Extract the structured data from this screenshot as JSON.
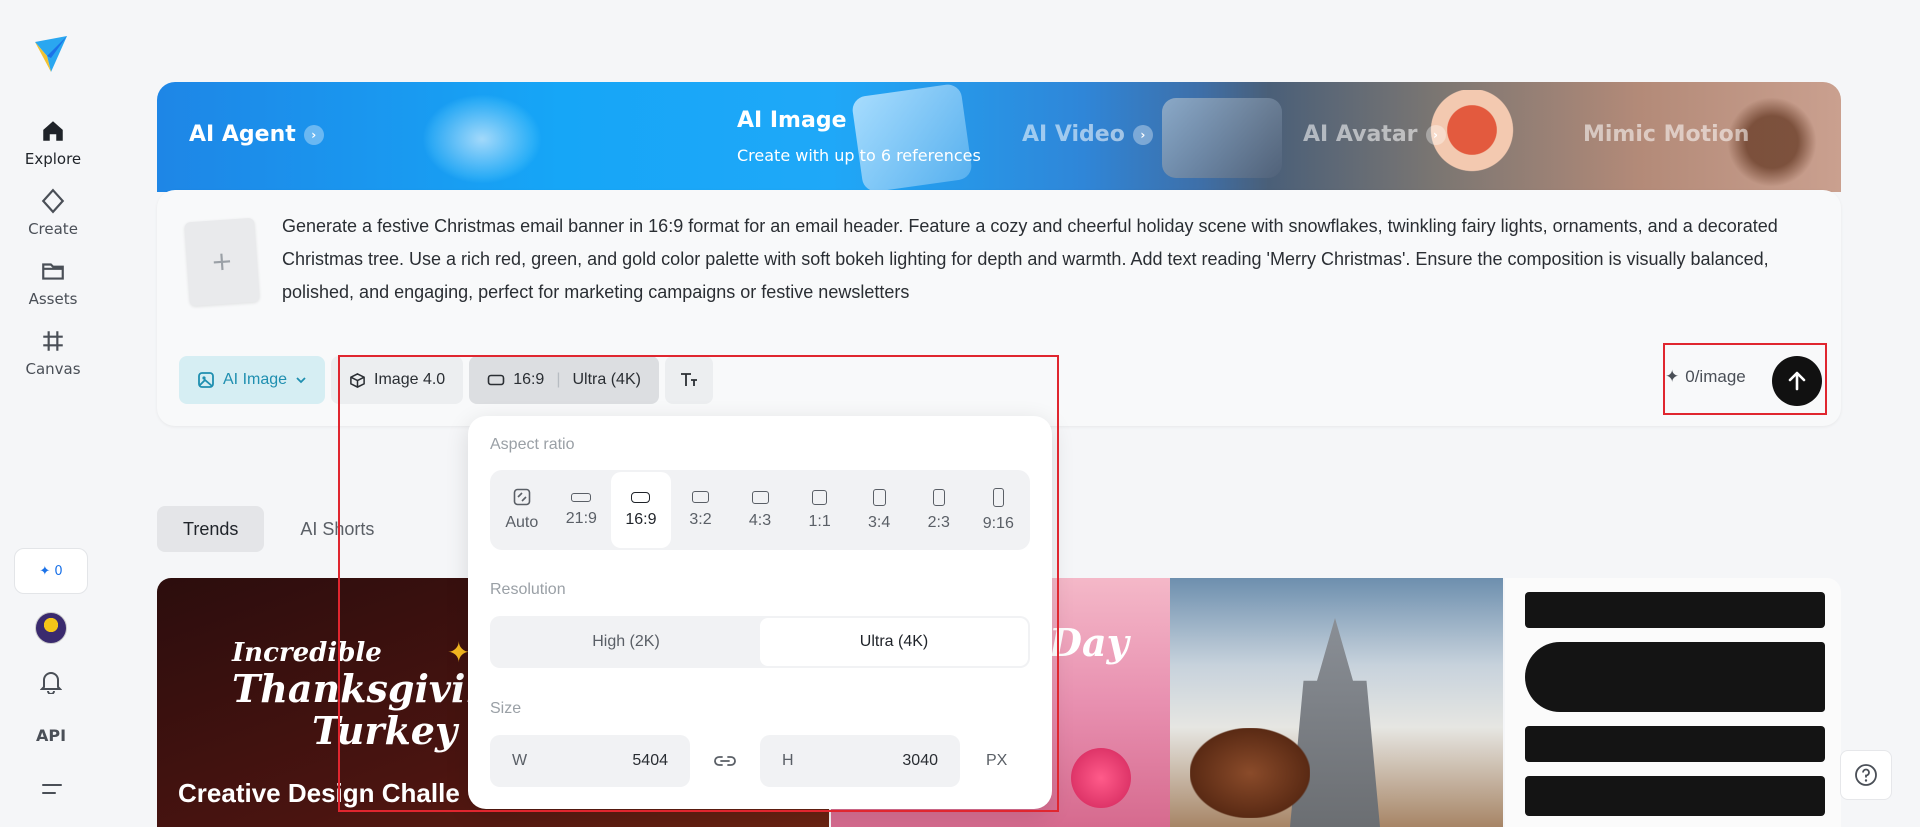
{
  "sidebar": {
    "items": [
      {
        "label": "Explore",
        "icon": "home-icon"
      },
      {
        "label": "Create",
        "icon": "diamond-icon"
      },
      {
        "label": "Assets",
        "icon": "folder-icon"
      },
      {
        "label": "Canvas",
        "icon": "canvas-icon"
      }
    ],
    "credits": "0",
    "api_label": "API"
  },
  "banner": {
    "tabs": [
      {
        "label": "AI Agent"
      },
      {
        "label": "AI Image",
        "subtitle": "Create with up to 6 references"
      },
      {
        "label": "AI Video"
      },
      {
        "label": "AI Avatar"
      },
      {
        "label": "Mimic Motion"
      }
    ]
  },
  "prompt": {
    "text": "Generate a festive Christmas email banner in 16:9 format for an email header. Feature a cozy and cheerful holiday scene with snowflakes, twinkling fairy lights, ornaments, and a decorated Christmas tree. Use a rich red, green, and gold color palette with soft bokeh lighting for depth and warmth. Add text reading 'Merry Christmas'. Ensure the composition is visually balanced, polished, and engaging, perfect for marketing campaigns or festive newsletters",
    "add_symbol": "+"
  },
  "toolbar": {
    "mode": "AI Image",
    "model": "Image 4.0",
    "ratio": "16:9",
    "resolution": "Ultra (4K)",
    "cost": "0/image"
  },
  "popover": {
    "aspect_title": "Aspect ratio",
    "ratios": [
      "Auto",
      "21:9",
      "16:9",
      "3:2",
      "4:3",
      "1:1",
      "3:4",
      "2:3",
      "9:16"
    ],
    "selected_ratio": "16:9",
    "resolution_title": "Resolution",
    "resolutions": [
      "High (2K)",
      "Ultra (4K)"
    ],
    "selected_resolution": "Ultra (4K)",
    "size_title": "Size",
    "width_label": "W",
    "width_value": "5404",
    "height_label": "H",
    "height_value": "3040",
    "unit": "PX"
  },
  "feed": {
    "tabs": [
      "Trends",
      "AI Shorts"
    ],
    "tile1": {
      "line1": "Incredible",
      "line2": "Thanksgiving",
      "line3": "Turkey",
      "caption": "Creative Design Challe"
    },
    "tile2": {
      "text": "Day"
    }
  },
  "colors": {
    "accent": "#1f8fb0",
    "highlight": "#e0262f",
    "send": "#111111"
  }
}
